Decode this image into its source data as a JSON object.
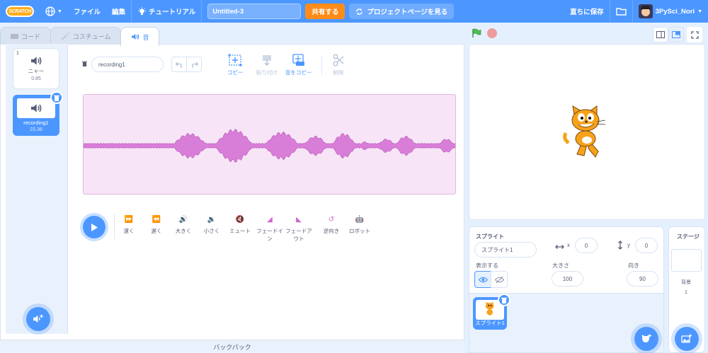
{
  "menu": {
    "logo": "SCRATCH",
    "file": "ファイル",
    "edit": "編集",
    "tutorial": "チュートリアル",
    "project_title": "Untitled-3",
    "share": "共有する",
    "see_project": "プロジェクトページを見る",
    "save_now": "直ちに保存",
    "username": "3PySci_Nori"
  },
  "tabs": {
    "code": "コード",
    "costumes": "コスチューム",
    "sounds": "音"
  },
  "sounds": [
    {
      "num": "1",
      "name": "ニャー",
      "duration": "0.85"
    },
    {
      "num": "2",
      "name": "recording1",
      "duration": "23.38"
    }
  ],
  "editor": {
    "sound_name": "recording1",
    "copy": "コピー",
    "paste": "貼り付け",
    "copy_to_new": "音をコピー",
    "delete": "削除"
  },
  "effects": [
    "速く",
    "遅く",
    "大きく",
    "小さく",
    "ミュート",
    "フェードイン",
    "フェードアウト",
    "逆向き",
    "ロボット"
  ],
  "backpack": "バックパック",
  "sprite_info": {
    "sprite_label": "スプライト",
    "sprite_name": "スプライト1",
    "x_label": "x",
    "x": "0",
    "y_label": "y",
    "y": "0",
    "show_label": "表示する",
    "size_label": "大きさ",
    "size": "100",
    "direction_label": "向き",
    "direction": "90"
  },
  "sprite_tile": {
    "name": "スプライト1"
  },
  "stage_panel": {
    "title": "ステージ",
    "backdrops_label": "背景",
    "backdrops_count": "1"
  },
  "colors": {
    "accent": "#4c97ff",
    "share": "#ff8c1a",
    "waveform": "#d97ed8",
    "wave_bg": "#f7e5f7",
    "effect_icon": "#cf63cf"
  }
}
